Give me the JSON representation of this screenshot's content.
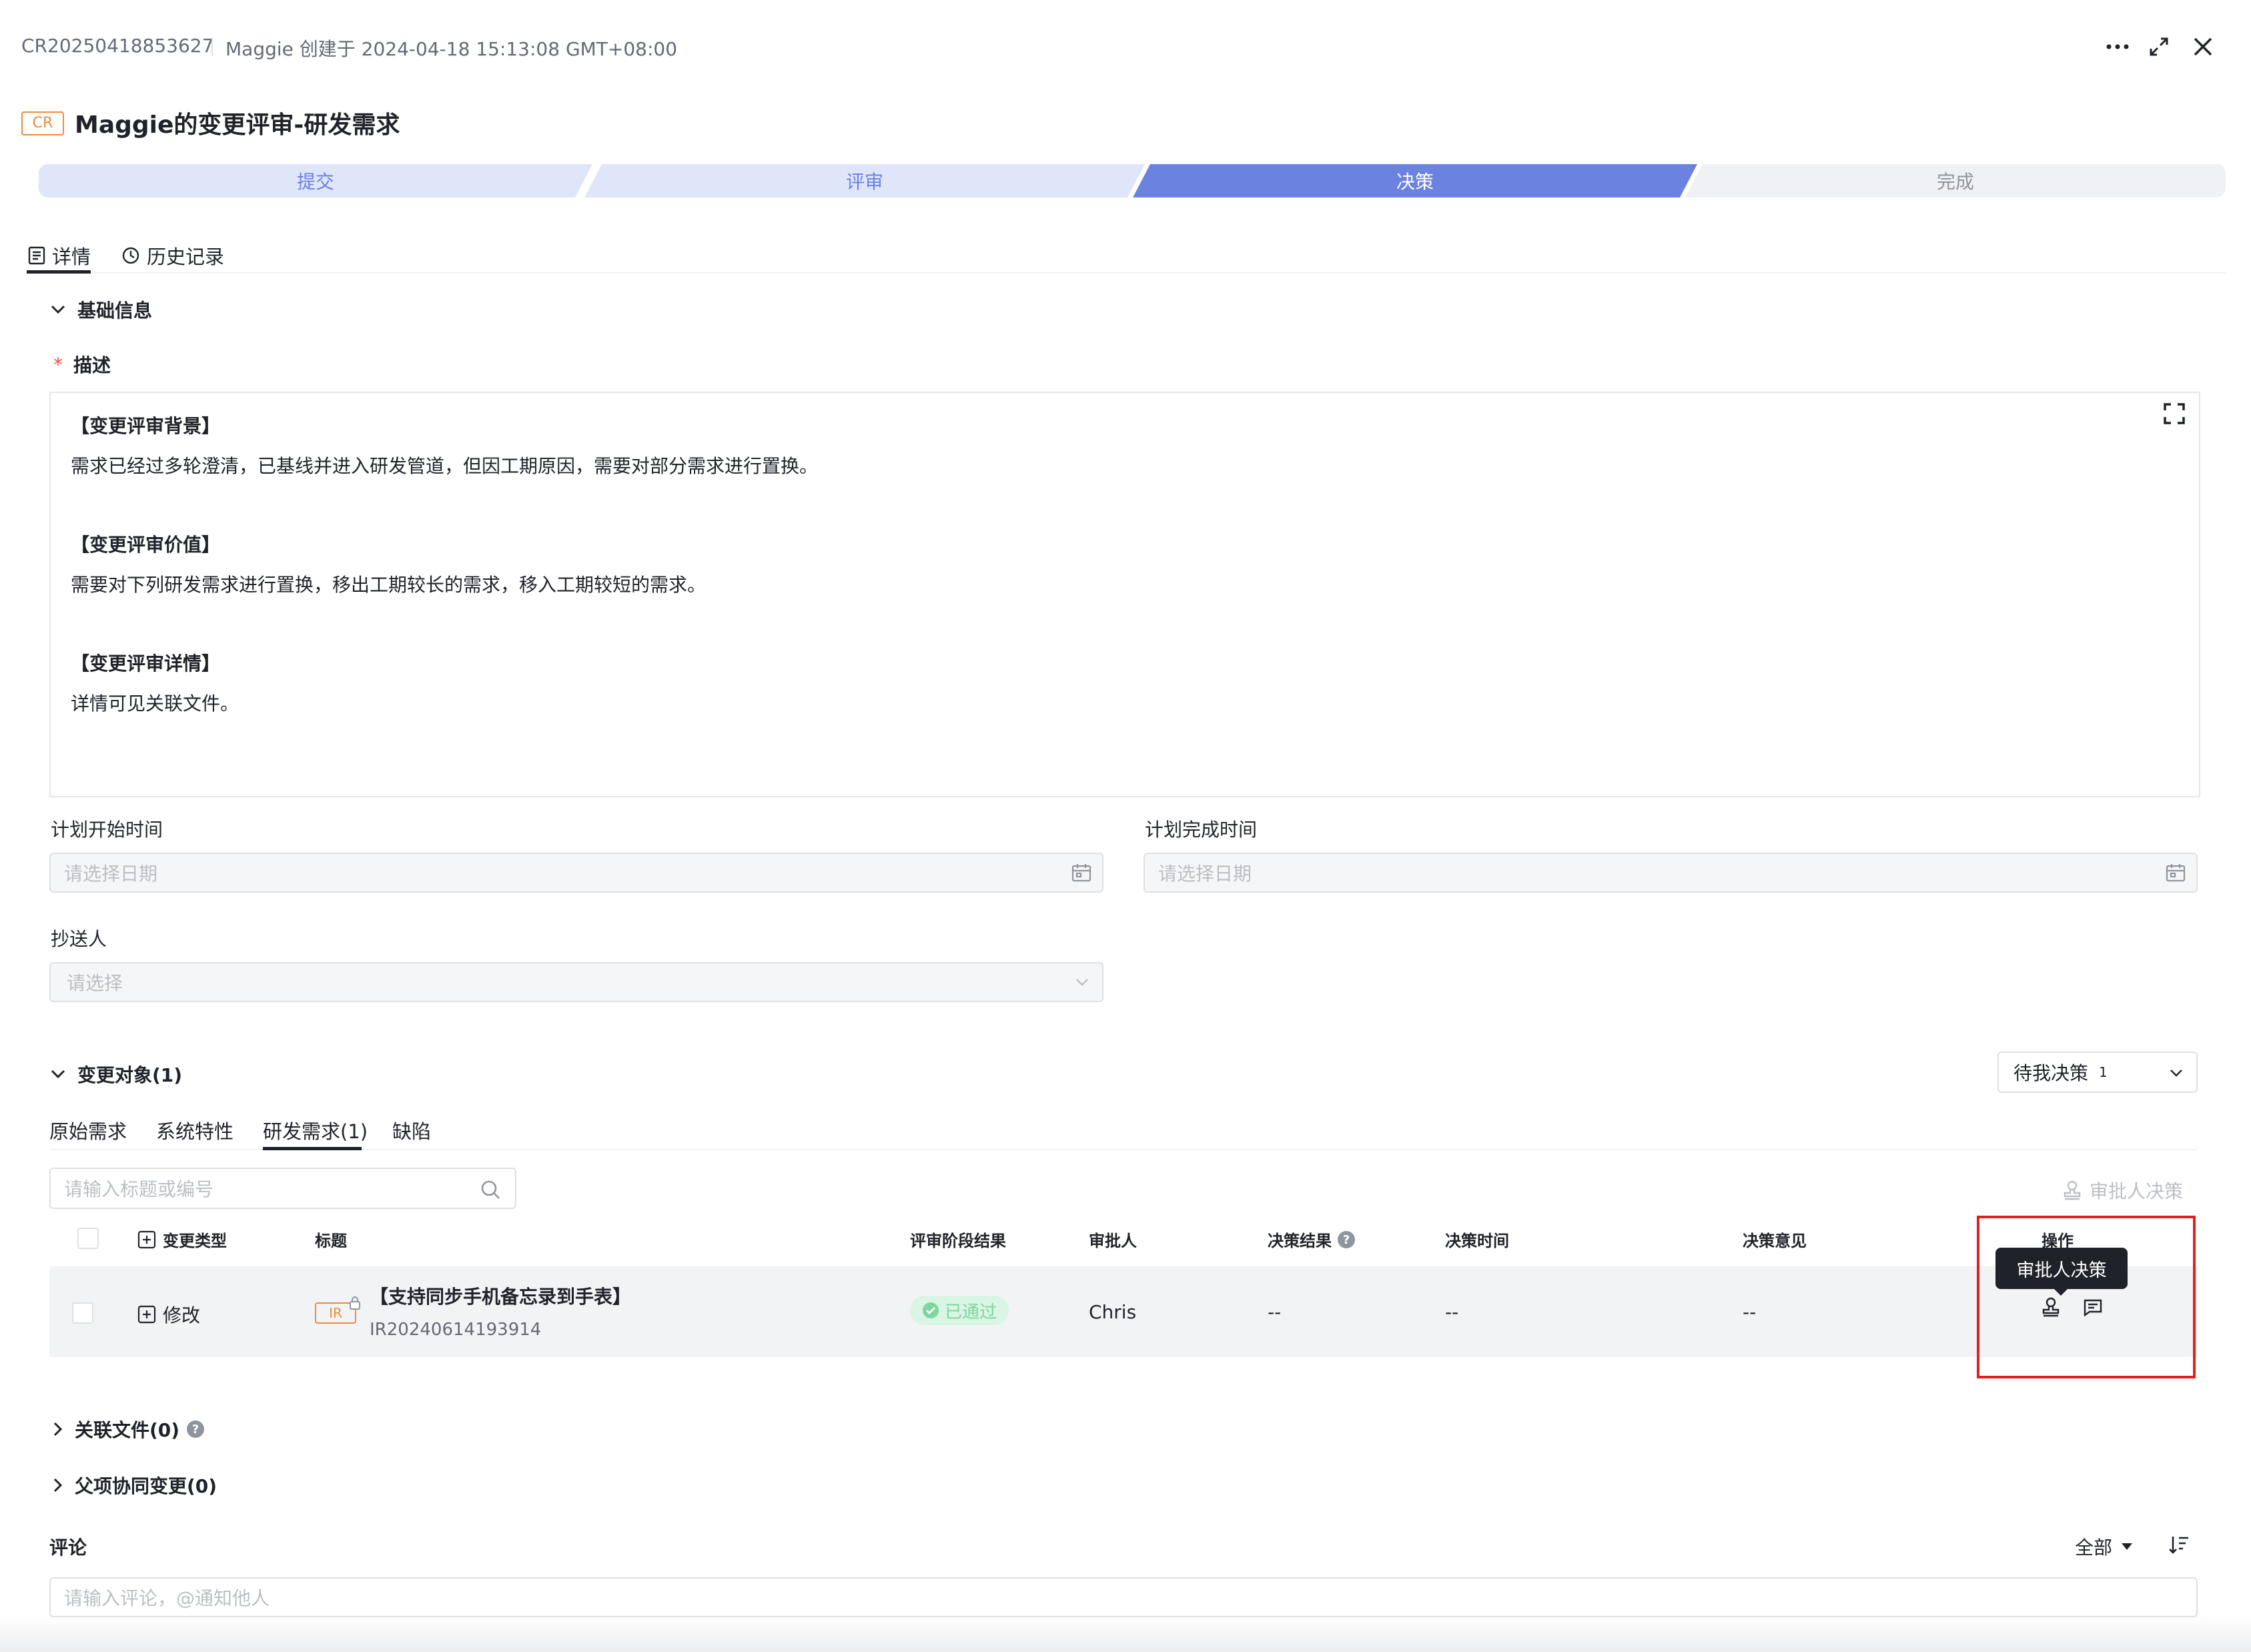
{
  "header": {
    "cr_id": "CR20250418853627",
    "creator_line": "Maggie 创建于 2024-04-18 15:13:08 GMT+08:00",
    "icons": [
      "more-icon",
      "expand-icon",
      "close-icon"
    ]
  },
  "title": {
    "tag": "CR",
    "text": "Maggie的变更评审-研发需求"
  },
  "stepper": {
    "steps": [
      "提交",
      "评审",
      "决策",
      "完成"
    ],
    "active_index": 2
  },
  "tabs": {
    "details": "详情",
    "history": "历史记录"
  },
  "basic_info": {
    "section_title": "基础信息",
    "description_label": "描述",
    "required_mark": "*",
    "description": {
      "h1": "【变更评审背景】",
      "p1": "需求已经过多轮澄清，已基线并进入研发管道，但因工期原因，需要对部分需求进行置换。",
      "h2": "【变更评审价值】",
      "p2": "需要对下列研发需求进行置换，移出工期较长的需求，移入工期较短的需求。",
      "h3": "【变更评审详情】",
      "p3": "详情可见关联文件。"
    },
    "start_label": "计划开始时间",
    "start_placeholder": "请选择日期",
    "end_label": "计划完成时间",
    "end_placeholder": "请选择日期",
    "cc_label": "抄送人",
    "cc_placeholder": "请选择"
  },
  "change_objects": {
    "section_title": "变更对象(1)",
    "filter_label": "待我决策",
    "filter_count": "1",
    "subtabs": [
      "原始需求",
      "系统特性",
      "研发需求(1)",
      "缺陷"
    ],
    "active_subtab": 2,
    "search_placeholder": "请输入标题或编号",
    "approver_decision_btn": "审批人决策",
    "columns": [
      "变更类型",
      "标题",
      "评审阶段结果",
      "审批人",
      "决策结果",
      "决策时间",
      "决策意见",
      "操作"
    ],
    "rows": [
      {
        "change_type": "修改",
        "tag": "IR",
        "title": "【支持同步手机备忘录到手表】",
        "id": "IR20240614193914",
        "review_result": "已通过",
        "approver": "Chris",
        "decision_result": "--",
        "decision_time": "--",
        "decision_opinion": "--"
      }
    ],
    "tooltip": "审批人决策"
  },
  "related_files": "关联文件(0)",
  "parent_changes": "父项协同变更(0)",
  "comments": {
    "label": "评论",
    "filter": "全部",
    "placeholder": "请输入评论，@通知他人"
  },
  "colors": {
    "accent": "#6b82e0",
    "accent_light": "#dfe6fa",
    "cr_tag": "#f08a3e",
    "success": "#7fd6a0",
    "highlight": "#e02020"
  }
}
